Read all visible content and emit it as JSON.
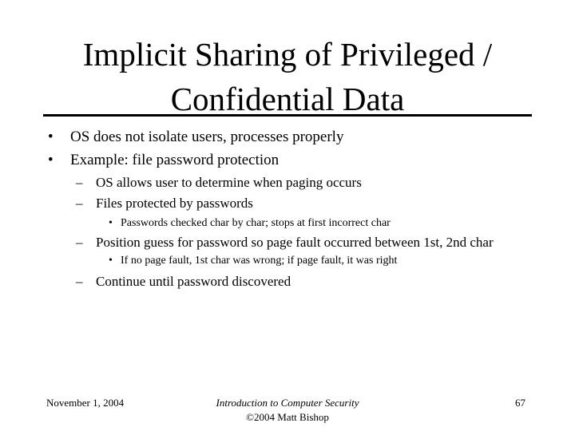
{
  "slide": {
    "title_line1": "Implicit Sharing of Privileged /",
    "title_line2": "Confidential Data",
    "bullets": [
      {
        "level": 1,
        "marker": "•",
        "text": "OS does not isolate users, processes properly"
      },
      {
        "level": 1,
        "marker": "•",
        "text": "Example: file password protection"
      },
      {
        "level": 2,
        "marker": "–",
        "text": "OS allows user to determine when paging occurs"
      },
      {
        "level": 2,
        "marker": "–",
        "text": "Files protected by passwords"
      },
      {
        "level": 3,
        "marker": "•",
        "text": "Passwords checked char by char; stops at first incorrect char"
      },
      {
        "level": 2,
        "marker": "–",
        "text": "Position guess for password so page fault occurred between 1st, 2nd char"
      },
      {
        "level": 3,
        "marker": "•",
        "text": "If no page fault, 1st char was wrong; if page fault, it was right"
      },
      {
        "level": 2,
        "marker": "–",
        "text": "Continue until password discovered"
      }
    ]
  },
  "footer": {
    "date": "November 1, 2004",
    "course": "Introduction to Computer Security",
    "copyright": "©2004 Matt Bishop",
    "page_number": "67"
  }
}
